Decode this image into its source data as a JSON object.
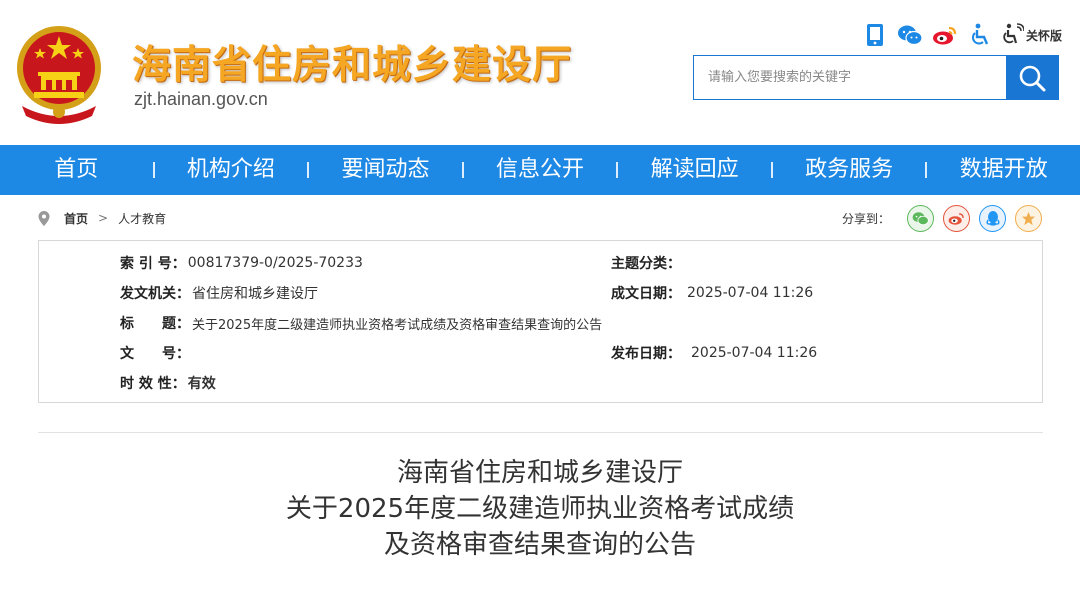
{
  "header": {
    "site_title": "海南省住房和城乡建设厅",
    "site_domain": "zjt.hainan.gov.cn",
    "care_mode_label": "关怀版",
    "icons": [
      "mobile-icon",
      "wechat-icon",
      "weibo-icon",
      "accessibility-icon",
      "care-mode-icon"
    ],
    "search": {
      "placeholder": "请输入您要搜索的关键字"
    }
  },
  "nav": {
    "items": [
      "首页",
      "机构介绍",
      "要闻动态",
      "信息公开",
      "解读回应",
      "政务服务",
      "数据开放"
    ]
  },
  "breadcrumb": {
    "home": "首页",
    "separator": ">",
    "current": "人才教育"
  },
  "share": {
    "label": "分享到：",
    "targets": [
      {
        "icon": "wechat-icon",
        "color": "#5cb85c"
      },
      {
        "icon": "weibo-icon",
        "color": "#e5533b"
      },
      {
        "icon": "qq-icon",
        "color": "#2196f3"
      },
      {
        "icon": "favorite-icon",
        "color": "#f0ad4e"
      }
    ]
  },
  "meta": {
    "index_label": "索 引 号：",
    "index_value": "00817379-0/2025-70233",
    "topic_label": "主题分类：",
    "topic_value": "",
    "issuer_label": "发文机关：",
    "issuer_value": "省住房和城乡建设厅",
    "created_label": "成文日期：",
    "created_value": "2025-07-04 11:26",
    "title_label": "标　　题：",
    "title_value": "关于2025年度二级建造师执业资格考试成绩及资格审查结果查询的公告",
    "docno_label": "文　　号：",
    "docno_value": "",
    "published_label": "发布日期：",
    "published_value": "2025-07-04 11:26",
    "validity_label": "时 效 性：",
    "validity_value": "有效"
  },
  "article": {
    "title_lines": [
      "海南省住房和城乡建设厅",
      "关于2025年度二级建造师执业资格考试成绩",
      "及资格审查结果查询的公告"
    ]
  },
  "colors": {
    "nav_bg": "#1e88e5",
    "search_btn": "#1976d2",
    "title_gold": "#f5a623"
  }
}
